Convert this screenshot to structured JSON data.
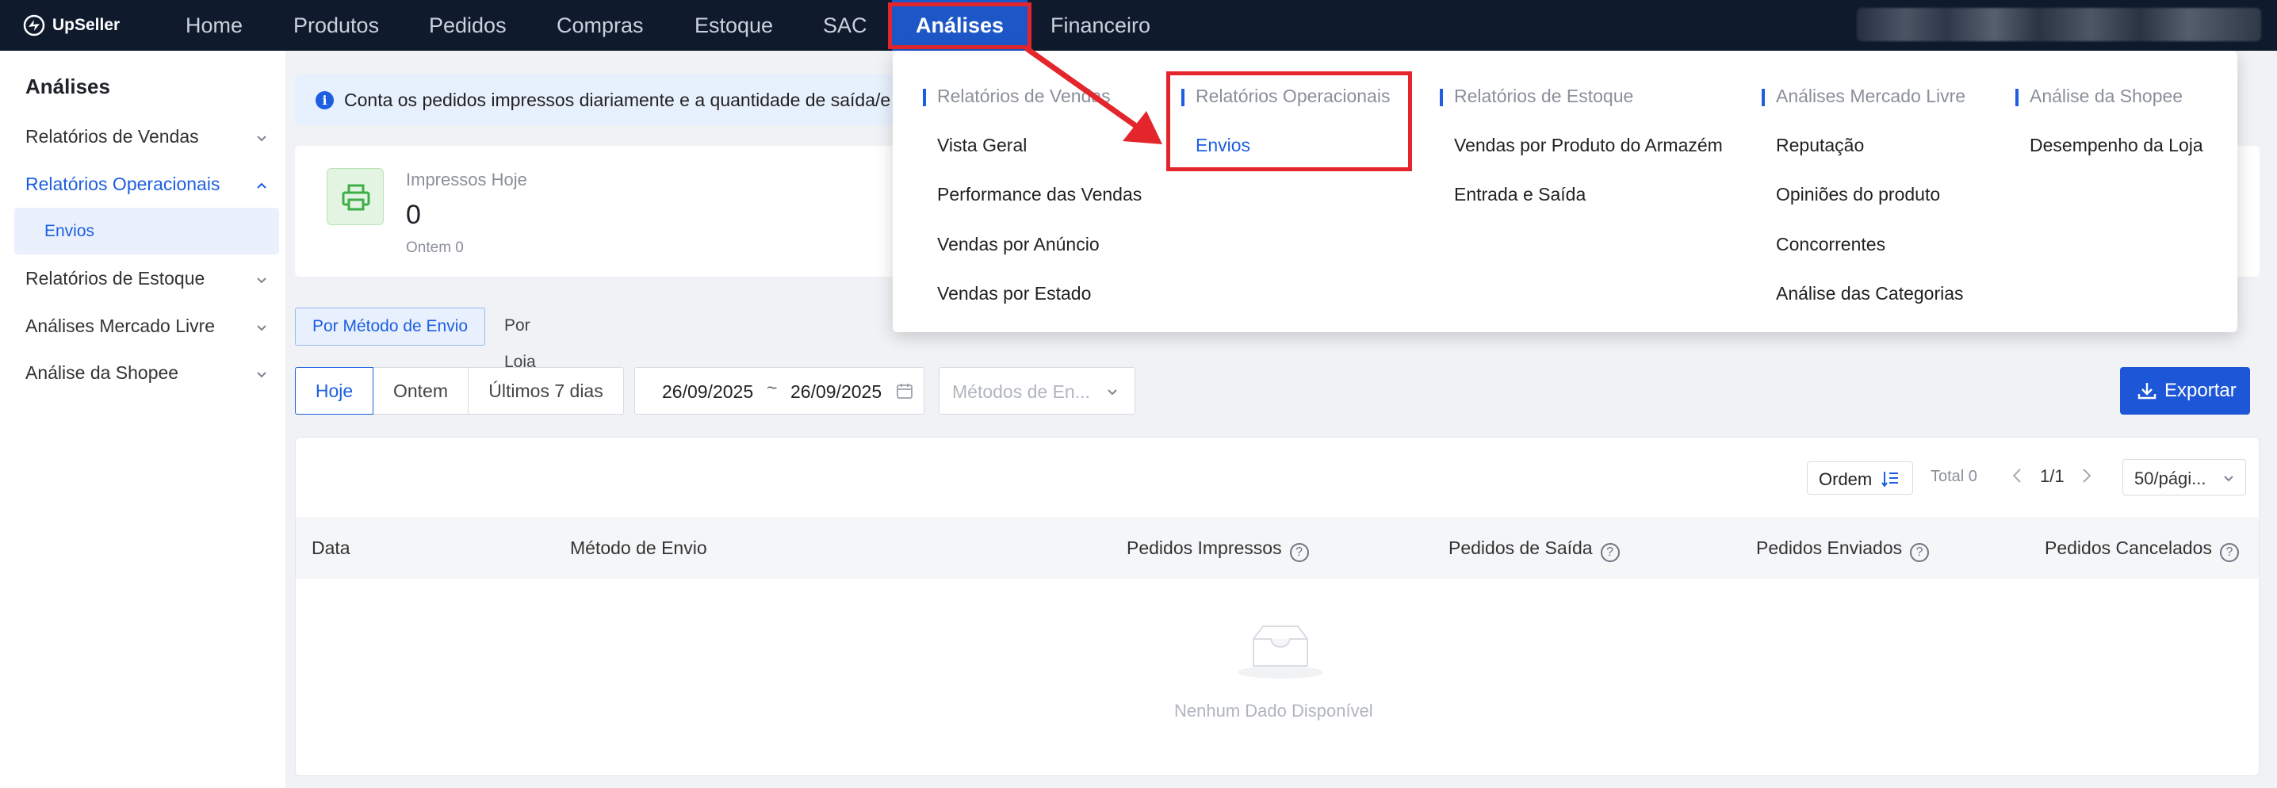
{
  "brand": {
    "name": "UpSeller"
  },
  "nav": {
    "items": [
      "Home",
      "Produtos",
      "Pedidos",
      "Compras",
      "Estoque",
      "SAC",
      "Análises",
      "Financeiro"
    ],
    "active": "Análises"
  },
  "sidebar": {
    "title": "Análises",
    "items": [
      {
        "label": "Relatórios de Vendas"
      },
      {
        "label": "Relatórios Operacionais"
      },
      {
        "label": "Relatórios de Estoque"
      },
      {
        "label": "Análises Mercado Livre"
      },
      {
        "label": "Análise da Shopee"
      }
    ],
    "subitem": "Envios"
  },
  "info": {
    "text": "Conta os pedidos impressos diariamente e a quantidade de saída/e"
  },
  "stats": {
    "label": "Impressos Hoje",
    "value": "0",
    "sub": "Ontem 0"
  },
  "view_tabs": [
    "Por Método de Envio",
    "Por Loja"
  ],
  "date_tabs": [
    "Hoje",
    "Ontem",
    "Últimos 7 dias"
  ],
  "date_range": {
    "start": "26/09/2025",
    "separator": "~",
    "end": "26/09/2025"
  },
  "method_select": {
    "placeholder": "Métodos de En..."
  },
  "export": {
    "label": "Exportar"
  },
  "table": {
    "order_label": "Ordem",
    "total": "Total 0",
    "page": "1/1",
    "page_size": "50/pági...",
    "columns": [
      "Data",
      "Método de Envio",
      "Pedidos Impressos",
      "Pedidos de Saída",
      "Pedidos Enviados",
      "Pedidos Cancelados"
    ],
    "empty_text": "Nenhum Dado Disponível"
  },
  "dropdown": {
    "columns": [
      {
        "title": "Relatórios de Vendas",
        "items": [
          "Vista Geral",
          "Performance das Vendas",
          "Vendas por Anúncio",
          "Vendas por Estado"
        ]
      },
      {
        "title": "Relatórios Operacionais",
        "items": [
          "Envios"
        ]
      },
      {
        "title": "Relatórios de Estoque",
        "items": [
          "Vendas por Produto do Armazém",
          "Entrada e Saída"
        ]
      },
      {
        "title": "Análises Mercado Livre",
        "items": [
          "Reputação",
          "Opiniões do produto",
          "Concorrentes",
          "Análise das Categorias"
        ]
      },
      {
        "title": "Análise da Shopee",
        "items": [
          "Desempenho da Loja"
        ]
      }
    ]
  },
  "colors": {
    "nav_bg": "#0f1b2d",
    "accent": "#1d5fe0",
    "highlight": "#e3262c",
    "export_bg": "#1d56d6"
  }
}
